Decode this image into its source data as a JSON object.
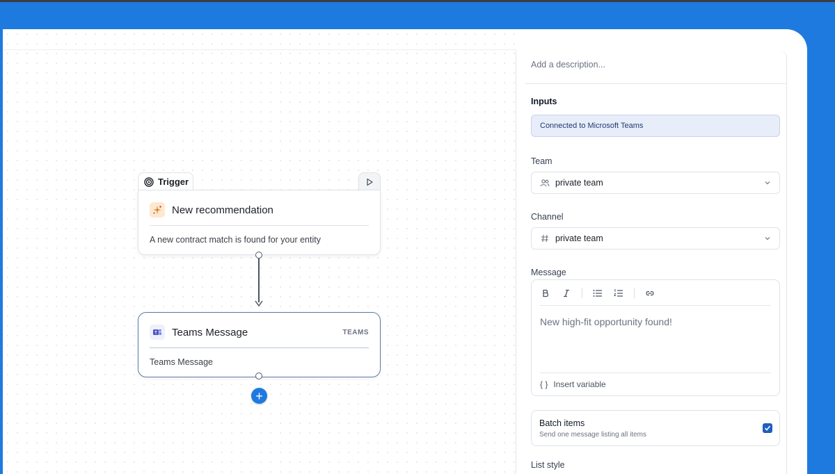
{
  "theme": {
    "brand": "#1f7ae0",
    "accent_node_border": "#5b7aa8",
    "connected_bg": "#e8edfa"
  },
  "canvas": {
    "trigger": {
      "tab_label": "Trigger",
      "tab_icon": "target-icon",
      "run_icon": "play-icon",
      "title": "New recommendation",
      "icon": "sparkle-icon",
      "description": "A new contract match is found for your entity"
    },
    "action": {
      "title": "Teams Message",
      "badge": "TEAMS",
      "icon": "teams-icon",
      "description": "Teams Message"
    },
    "add_button": "+"
  },
  "panel": {
    "description_placeholder": "Add a description...",
    "inputs_label": "Inputs",
    "connected_text": "Connected to Microsoft Teams",
    "team": {
      "label": "Team",
      "value": "private team",
      "icon": "users-icon"
    },
    "channel": {
      "label": "Channel",
      "value": "private team",
      "icon": "hash-icon"
    },
    "message": {
      "label": "Message",
      "toolbar": [
        "bold-icon",
        "italic-icon",
        "bullet-list-icon",
        "numbered-list-icon",
        "link-icon"
      ],
      "text": "New high-fit opportunity found!",
      "insert_variable_glyph": "{ }",
      "insert_variable": "Insert variable"
    },
    "batch": {
      "title": "Batch items",
      "subtitle": "Send one message listing all items",
      "checked": true
    },
    "list_style_label": "List style"
  }
}
